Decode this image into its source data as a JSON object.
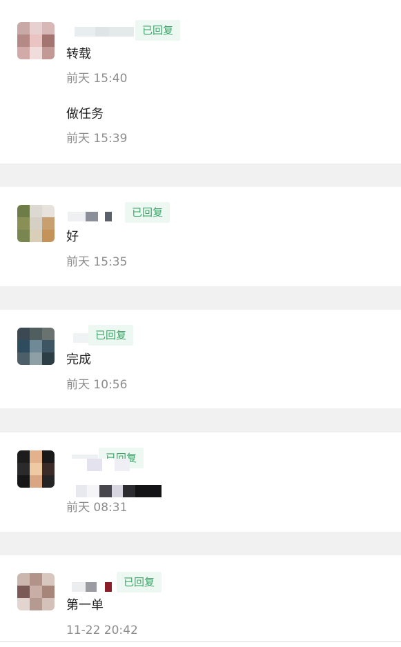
{
  "badge_label": "已回复",
  "badge_colors": {
    "text": "#3aa568",
    "background": "#eef8f2"
  },
  "comments": [
    {
      "badge": "已回复",
      "avatar": [
        "#c9a9a6",
        "#e7d0cf",
        "#d8b8b6",
        "#b58a86",
        "#e9c4c2",
        "#a47470",
        "#d2aba8",
        "#f0dcdb",
        "#c39995"
      ],
      "replies": [
        {
          "text": "转载",
          "time": "前天 15:40"
        },
        {
          "text": "做任务",
          "time": "前天 15:39"
        }
      ]
    },
    {
      "badge": "已回复",
      "avatar": [
        "#6e7d48",
        "#dcd9d2",
        "#e7e3dc",
        "#8a8f56",
        "#d6d0c4",
        "#c8a070",
        "#7a8650",
        "#d9cfb8",
        "#c4935a"
      ],
      "replies": [
        {
          "text": "好",
          "time": "前天 15:35"
        }
      ]
    },
    {
      "badge": "已回复",
      "avatar": [
        "#3b4a52",
        "#505e60",
        "#6a7270",
        "#2f4c5e",
        "#6f8a96",
        "#3e5663",
        "#4c5f68",
        "#8ea0a6",
        "#2d3d46"
      ],
      "replies": [
        {
          "text": "完成",
          "time": "前天 10:56"
        }
      ]
    },
    {
      "badge": "已回复",
      "avatar": [
        "#1c1c1c",
        "#e3b28c",
        "#1a1a1a",
        "#2a2a2a",
        "#efc8a4",
        "#3a2a28",
        "#161616",
        "#d9a582",
        "#242424"
      ],
      "replies": [
        {
          "text": "",
          "time": "前天 08:31"
        }
      ]
    },
    {
      "badge": "已回复",
      "avatar": [
        "#cbb7ae",
        "#b29389",
        "#d8c7bf",
        "#7b5a55",
        "#c9aea5",
        "#a88579",
        "#e2d5cf",
        "#b59a91",
        "#d4c2ba"
      ],
      "replies": [
        {
          "text": "第一单",
          "time": "11-22 20:42"
        }
      ]
    }
  ]
}
